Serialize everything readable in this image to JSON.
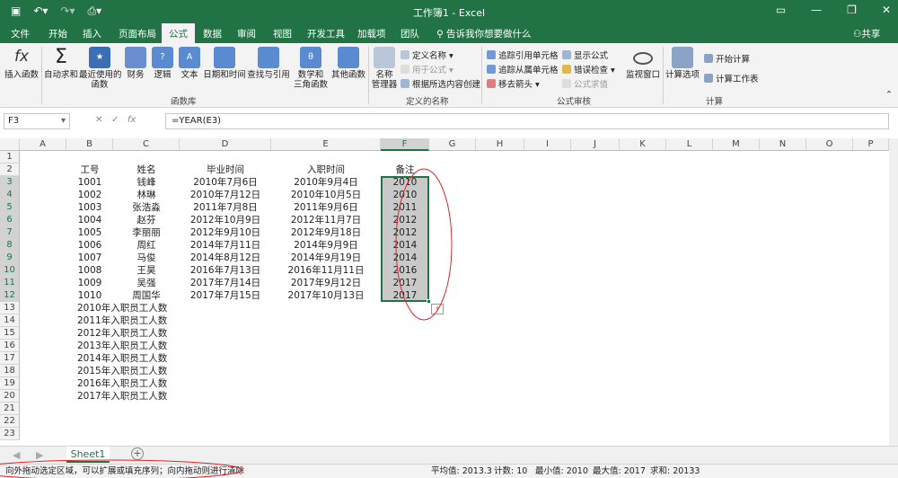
{
  "window": {
    "title": "工作簿1 - Excel"
  },
  "tabs": [
    "文件",
    "开始",
    "插入",
    "页面布局",
    "公式",
    "数据",
    "审阅",
    "视图",
    "开发工具",
    "加载项",
    "团队"
  ],
  "active_tab": "公式",
  "tell_me": "告诉我你想要做什么",
  "share": "共享",
  "ribbon": {
    "insert_fn": "插入函数",
    "autosum": "自动求和",
    "recent": "最近使用的\n函数",
    "finance": "财务",
    "logic": "逻辑",
    "text": "文本",
    "datetime": "日期和时间",
    "lookup": "查找与引用",
    "math": "数学和\n三角函数",
    "other": "其他函数",
    "group_lib": "函数库",
    "name_mgr": "名称\n管理器",
    "define_name": "定义名称",
    "use_in_formula": "用于公式",
    "create_from_sel": "根据所选内容创建",
    "group_names": "定义的名称",
    "trace_prec": "追踪引用单元格",
    "trace_dep": "追踪从属单元格",
    "remove_arrows": "移去箭头",
    "show_formulas": "显示公式",
    "error_check": "错误检查",
    "eval_formula": "公式求值",
    "group_audit": "公式审核",
    "watch": "监视窗口",
    "calc_opts": "计算选项",
    "calc_now": "开始计算",
    "calc_sheet": "计算工作表",
    "group_calc": "计算"
  },
  "name_box": "F3",
  "formula": "=YEAR(E3)",
  "columns": [
    "A",
    "B",
    "C",
    "D",
    "E",
    "F",
    "G",
    "H",
    "I",
    "J",
    "K",
    "L",
    "M",
    "N",
    "O",
    "P"
  ],
  "rows": [
    "1",
    "2",
    "3",
    "4",
    "5",
    "6",
    "7",
    "8",
    "9",
    "10",
    "11",
    "12",
    "13",
    "14",
    "15",
    "16",
    "17",
    "18",
    "19",
    "20",
    "21",
    "22",
    "23"
  ],
  "headers": {
    "id": "工号",
    "name": "姓名",
    "grad": "毕业时间",
    "hire": "入职时间",
    "note": "备注"
  },
  "records": [
    {
      "id": "1001",
      "name": "钱峰",
      "grad": "2010年7月6日",
      "hire": "2010年9月4日",
      "year": "2010"
    },
    {
      "id": "1002",
      "name": "林琳",
      "grad": "2010年7月12日",
      "hire": "2010年10月5日",
      "year": "2010"
    },
    {
      "id": "1003",
      "name": "张浩淼",
      "grad": "2011年7月8日",
      "hire": "2011年9月6日",
      "year": "2011"
    },
    {
      "id": "1004",
      "name": "赵芬",
      "grad": "2012年10月9日",
      "hire": "2012年11月7日",
      "year": "2012"
    },
    {
      "id": "1005",
      "name": "李丽丽",
      "grad": "2012年9月10日",
      "hire": "2012年9月18日",
      "year": "2012"
    },
    {
      "id": "1006",
      "name": "周红",
      "grad": "2014年7月11日",
      "hire": "2014年9月9日",
      "year": "2014"
    },
    {
      "id": "1007",
      "name": "马俊",
      "grad": "2014年8月12日",
      "hire": "2014年9月19日",
      "year": "2014"
    },
    {
      "id": "1008",
      "name": "王昊",
      "grad": "2016年7月13日",
      "hire": "2016年11月11日",
      "year": "2016"
    },
    {
      "id": "1009",
      "name": "吴强",
      "grad": "2017年7月14日",
      "hire": "2017年9月12日",
      "year": "2017"
    },
    {
      "id": "1010",
      "name": "周国华",
      "grad": "2017年7月15日",
      "hire": "2017年10月13日",
      "year": "2017"
    }
  ],
  "summary": [
    "2010年入职员工人数",
    "2011年入职员工人数",
    "2012年入职员工人数",
    "2013年入职员工人数",
    "2014年入职员工人数",
    "2015年入职员工人数",
    "2016年入职员工人数",
    "2017年入职员工人数"
  ],
  "sheet_tab": "Sheet1",
  "status": {
    "message": "向外拖动选定区域，可以扩展或填充序列；向内拖动则进行清除",
    "average": "平均值: 2013.3",
    "count": "计数: 10",
    "min": "最小值: 2010",
    "max": "最大值: 2017",
    "sum": "求和: 20133"
  },
  "colors": {
    "excel_green": "#217346",
    "annotation_red": "#e0262b",
    "selection": "#c9c9c9"
  }
}
